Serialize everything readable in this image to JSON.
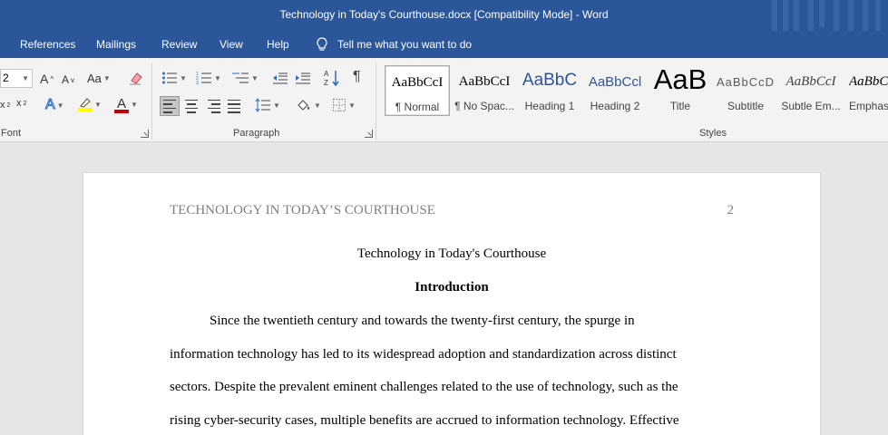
{
  "window": {
    "title": "Technology in Today's Courthouse.docx [Compatibility Mode]  -  Word"
  },
  "tabs": [
    {
      "label": "References"
    },
    {
      "label": "Mailings"
    },
    {
      "label": "Review"
    },
    {
      "label": "View"
    },
    {
      "label": "Help"
    }
  ],
  "tell_me": {
    "label": "Tell me what you want to do"
  },
  "ribbon": {
    "font": {
      "size_value": "2",
      "grow_label": "A",
      "shrink_label": "A",
      "case_label": "Aa",
      "sub_label": "x",
      "sup_label": "x",
      "effects_label": "A",
      "color_label": "A",
      "group_label": "Font"
    },
    "paragraph": {
      "pilcrow": "¶",
      "group_label": "Paragraph"
    },
    "styles": {
      "group_label": "Styles",
      "items": [
        {
          "sample": "AaBbCcI",
          "name": "¶ Normal"
        },
        {
          "sample": "AaBbCcI",
          "name": "¶ No Spac..."
        },
        {
          "sample": "AaBbC",
          "name": "Heading 1"
        },
        {
          "sample": "AaBbCcl",
          "name": "Heading 2"
        },
        {
          "sample": "AaB",
          "name": "Title"
        },
        {
          "sample": "AaBbCcD",
          "name": "Subtitle"
        },
        {
          "sample": "AaBbCcI",
          "name": "Subtle Em..."
        },
        {
          "sample": "AaBbCc",
          "name": "Emphas"
        }
      ]
    },
    "colors": {
      "highlight": "#ffff00",
      "font_color": "#c00000"
    }
  },
  "document": {
    "header_text": "TECHNOLOGY IN TODAY’S COURTHOUSE",
    "page_number": "2",
    "title": "Technology in Today's Courthouse",
    "heading": "Introduction",
    "lines": [
      "Since the twentieth century and towards the twenty-first century, the spurge in",
      "information technology has led to its widespread adoption and standardization across distinct",
      "sectors. Despite the prevalent eminent challenges related to the use of technology, such as the",
      "rising cyber-security cases, multiple benefits are accrued to information technology. Effective"
    ]
  },
  "theme": {
    "brand": "#2b579a"
  }
}
